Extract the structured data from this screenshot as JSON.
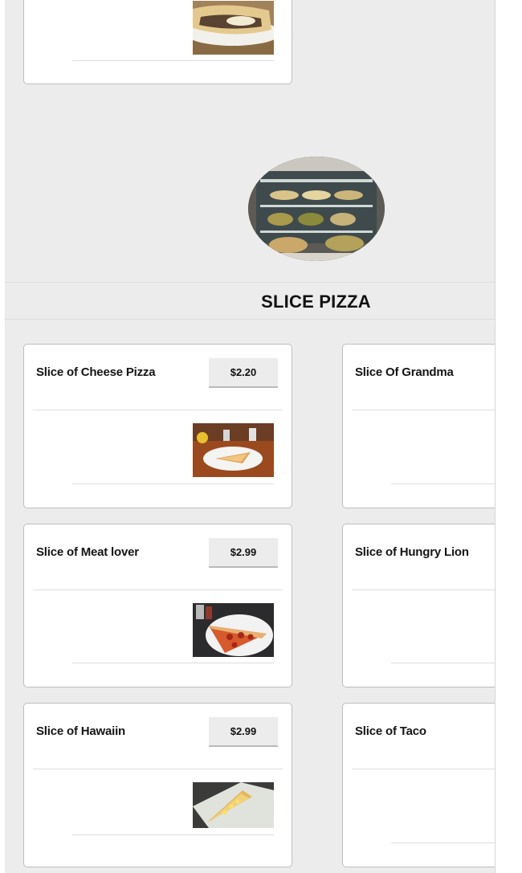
{
  "section": {
    "title": "SLICE PIZZA"
  },
  "items": [
    {
      "name": "Slice of Cheese Pizza",
      "price": "$2.20"
    },
    {
      "name": "Slice Of Grandma",
      "price": ""
    },
    {
      "name": "Slice of Meat lover",
      "price": "$2.99"
    },
    {
      "name": "Slice of Hungry Lion",
      "price": ""
    },
    {
      "name": "Slice of Hawaiin",
      "price": "$2.99"
    },
    {
      "name": "Slice of Taco",
      "price": ""
    }
  ],
  "colors": {
    "background": "#ececec",
    "card": "#ffffff",
    "price_bg": "#ececec",
    "text": "#111111"
  }
}
